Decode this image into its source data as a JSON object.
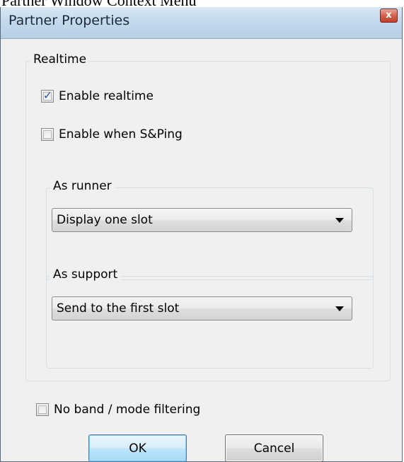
{
  "page_caption": "Partner Window Context Menu",
  "window": {
    "title": "Partner Properties",
    "close_label": "x"
  },
  "realtime": {
    "group_label": "Realtime",
    "enable_realtime": {
      "label": "Enable realtime",
      "checked": true
    },
    "enable_when_sping": {
      "label": "Enable when S&Ping",
      "checked": false
    },
    "as_runner": {
      "group_label": "As runner",
      "selected": "Display one slot"
    },
    "as_support": {
      "group_label": "As support",
      "selected": "Send to the first slot"
    }
  },
  "no_band_filtering": {
    "label": "No band / mode filtering",
    "checked": false
  },
  "buttons": {
    "ok_label": "OK",
    "cancel_label": "Cancel"
  },
  "colors": {
    "accent_check": "#2a4ea0",
    "titlebar": "#c4d9ec",
    "close_button": "#c0402d"
  }
}
